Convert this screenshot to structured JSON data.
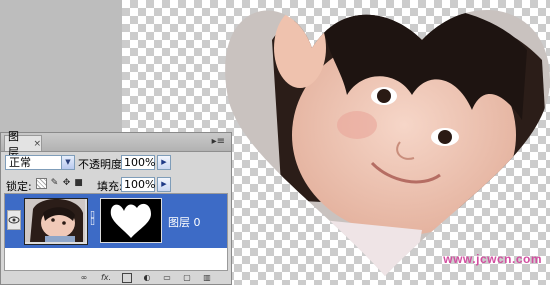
{
  "watermark": {
    "url": "www.jcwcn.com"
  },
  "layers_panel": {
    "tab_label": "图层",
    "close_icon": "×",
    "menu_icon": "panel-menu-icon",
    "blend_mode": "正常",
    "opacity_label": "不透明度:",
    "opacity_value": "100%",
    "lock_label": "锁定:",
    "fill_label": "填充:",
    "fill_value": "100%",
    "layers": [
      {
        "name": "图层 0",
        "visible": true,
        "has_mask": true
      }
    ],
    "bottom_icons": [
      "link-icon",
      "fx-icon",
      "add-mask-icon",
      "adjustment-layer-icon",
      "group-folder-icon",
      "new-layer-icon",
      "trash-icon"
    ]
  },
  "colors": {
    "selection": "#3d6bc6",
    "watermark": "#d24fa0"
  }
}
